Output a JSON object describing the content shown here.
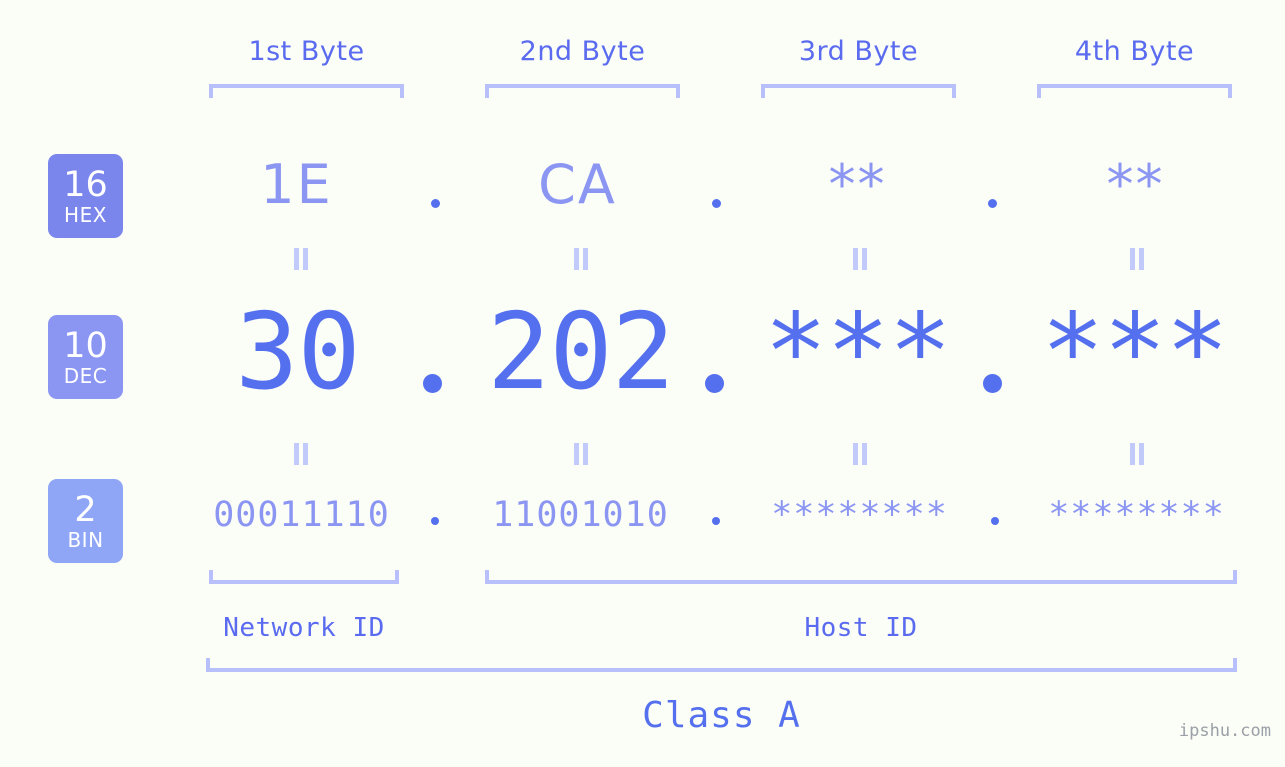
{
  "page": {
    "background_color": "#fbfdf7",
    "accent_color": "#5570ee",
    "light_accent_color": "#8b95f2",
    "bracket_color": "#b7c0fa",
    "watermark": "ipshu.com"
  },
  "byte_headers": [
    {
      "label": "1st Byte"
    },
    {
      "label": "2nd Byte"
    },
    {
      "label": "3rd Byte"
    },
    {
      "label": "4th Byte"
    }
  ],
  "bases": [
    {
      "number": "16",
      "abbr": "HEX",
      "color": "#7b86ec"
    },
    {
      "number": "10",
      "abbr": "DEC",
      "color": "#8b95f2"
    },
    {
      "number": "2",
      "abbr": "BIN",
      "color": "#8fa6f7"
    }
  ],
  "rows": {
    "hex": {
      "values": [
        "1E",
        "CA",
        "**",
        "**"
      ]
    },
    "dec": {
      "values": [
        "30",
        "202",
        "***",
        "***"
      ]
    },
    "bin": {
      "values": [
        "00011110",
        "11001010",
        "********",
        "********"
      ]
    }
  },
  "separators": {
    "dot": ".",
    "equals": "="
  },
  "id_sections": [
    {
      "label": "Network ID"
    },
    {
      "label": "Host ID"
    }
  ],
  "class_section": {
    "label": "Class A"
  }
}
